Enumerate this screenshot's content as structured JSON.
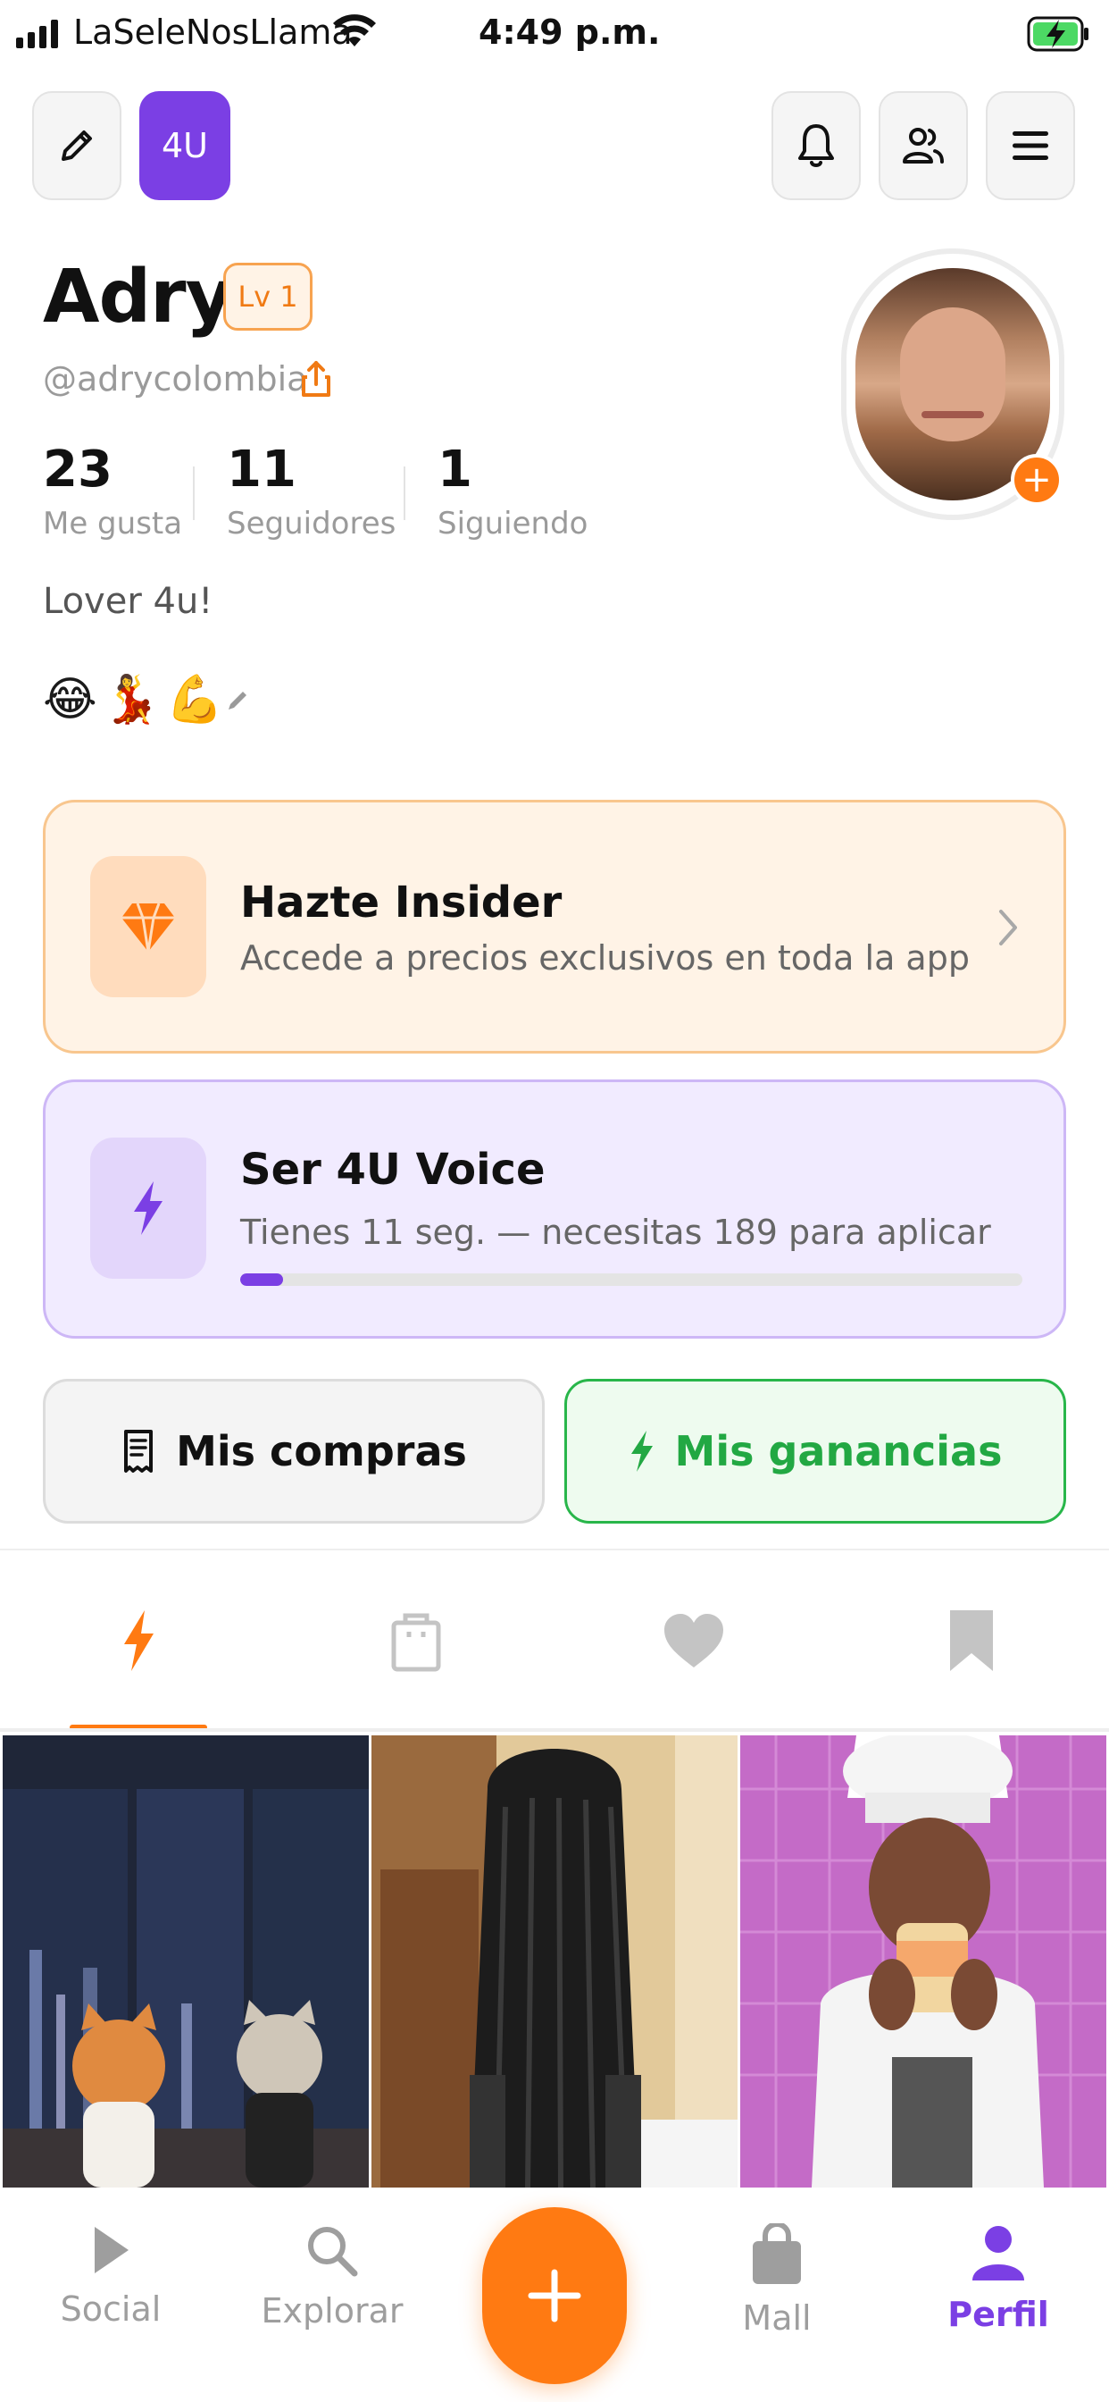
{
  "status_bar": {
    "carrier": "LaSeleNosLlama",
    "time": "4:49 p.m."
  },
  "app": {
    "logo": "4U",
    "accent_color": "#7b3fe4",
    "orange": "#ff7a12",
    "green": "#22a843"
  },
  "header_buttons": {
    "left": [
      {
        "icon": "pencil-icon"
      },
      {
        "icon": "4u-logo"
      }
    ],
    "right": [
      {
        "icon": "bell-icon"
      },
      {
        "icon": "people-icon"
      },
      {
        "icon": "menu-icon"
      }
    ]
  },
  "profile": {
    "name": "Adry",
    "level": "Lv 1",
    "handle": "@adrycolombia",
    "stats": [
      {
        "value": "23",
        "label": "Me gusta"
      },
      {
        "value": "11",
        "label": "Seguidores"
      },
      {
        "value": "1",
        "label": "Siguiendo"
      }
    ],
    "bio": "Lover 4u!",
    "emojis": "😂💃💪",
    "avatar_add": "+"
  },
  "insider_card": {
    "title": "Hazte Insider",
    "subtitle": "Accede a precios exclusivos en toda la app"
  },
  "voice_card": {
    "title": "Ser 4U Voice",
    "subtitle": "Tienes 11 seg. — necesitas 189 para aplicar",
    "progress_seconds": 11,
    "required_seconds": 189
  },
  "actions": {
    "compras": "Mis compras",
    "ganancias": "Mis ganancias"
  },
  "tabs": [
    {
      "icon": "bolt-icon",
      "active": true
    },
    {
      "icon": "bag-icon",
      "active": false
    },
    {
      "icon": "heart-icon",
      "active": false
    },
    {
      "icon": "bookmark-icon",
      "active": false
    }
  ],
  "bottom_nav": {
    "social": "Social",
    "explorar": "Explorar",
    "create": "+",
    "mall": "Mall",
    "perfil": "Perfil"
  }
}
